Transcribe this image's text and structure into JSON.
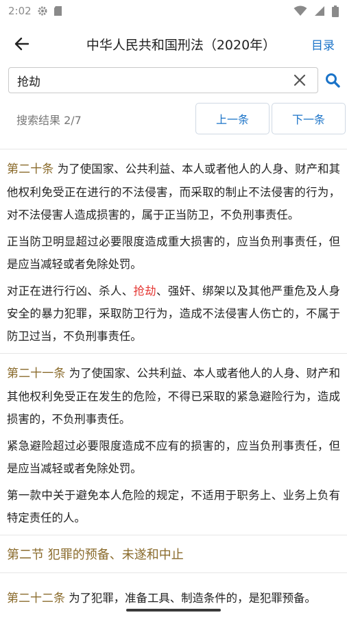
{
  "status_bar": {
    "time": "2:02"
  },
  "header": {
    "title": "中华人民共和国刑法（2020年）",
    "toc_label": "目录"
  },
  "search": {
    "value": "抢劫",
    "placeholder": ""
  },
  "results": {
    "count_text": "搜索结果 2/7",
    "prev_label": "上一条",
    "next_label": "下一条"
  },
  "colors": {
    "accent": "#1a73c8",
    "article_number": "#8a6b2c",
    "highlight": "#e53935"
  },
  "articles": [
    {
      "number": "第二十条",
      "p1_text": " 为了使国家、公共利益、本人或者他人的人身、财产和其他权利免受正在进行的不法侵害，而采取的制止不法侵害的行为，对不法侵害人造成损害的，属于正当防卫，不负刑事责任。",
      "p2": "正当防卫明显超过必要限度造成重大损害的，应当负刑事责任，但是应当减轻或者免除处罚。",
      "p3_before": "对正在进行行凶、杀人、",
      "p3_highlight": "抢劫",
      "p3_after": "、强奸、绑架以及其他严重危及人身安全的暴力犯罪，采取防卫行为，造成不法侵害人伤亡的，不属于防卫过当，不负刑事责任。"
    },
    {
      "number": "第二十一条",
      "p1_text": " 为了使国家、公共利益、本人或者他人的人身、财产和其他权利免受正在发生的危险，不得已采取的紧急避险行为，造成损害的，不负刑事责任。",
      "p2": "紧急避险超过必要限度造成不应有的损害的，应当负刑事责任，但是应当减轻或者免除处罚。",
      "p3": "第一款中关于避免本人危险的规定，不适用于职务上、业务上负有特定责任的人。"
    }
  ],
  "section": {
    "heading": "第二节 犯罪的预备、未遂和中止"
  },
  "partial_article": {
    "number": "第二十二条",
    "text": " 为了犯罪，准备工具、制造条件的，是犯罪预备。"
  }
}
